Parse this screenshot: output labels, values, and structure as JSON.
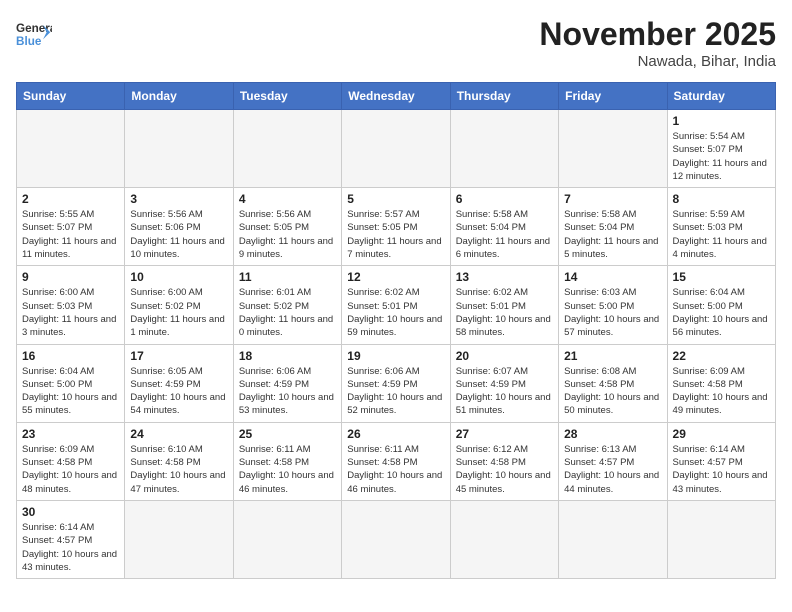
{
  "logo": {
    "text_general": "General",
    "text_blue": "Blue"
  },
  "title": "November 2025",
  "subtitle": "Nawada, Bihar, India",
  "days_of_week": [
    "Sunday",
    "Monday",
    "Tuesday",
    "Wednesday",
    "Thursday",
    "Friday",
    "Saturday"
  ],
  "weeks": [
    [
      {
        "day": "",
        "info": ""
      },
      {
        "day": "",
        "info": ""
      },
      {
        "day": "",
        "info": ""
      },
      {
        "day": "",
        "info": ""
      },
      {
        "day": "",
        "info": ""
      },
      {
        "day": "",
        "info": ""
      },
      {
        "day": "1",
        "info": "Sunrise: 5:54 AM\nSunset: 5:07 PM\nDaylight: 11 hours and 12 minutes."
      }
    ],
    [
      {
        "day": "2",
        "info": "Sunrise: 5:55 AM\nSunset: 5:07 PM\nDaylight: 11 hours and 11 minutes."
      },
      {
        "day": "3",
        "info": "Sunrise: 5:56 AM\nSunset: 5:06 PM\nDaylight: 11 hours and 10 minutes."
      },
      {
        "day": "4",
        "info": "Sunrise: 5:56 AM\nSunset: 5:05 PM\nDaylight: 11 hours and 9 minutes."
      },
      {
        "day": "5",
        "info": "Sunrise: 5:57 AM\nSunset: 5:05 PM\nDaylight: 11 hours and 7 minutes."
      },
      {
        "day": "6",
        "info": "Sunrise: 5:58 AM\nSunset: 5:04 PM\nDaylight: 11 hours and 6 minutes."
      },
      {
        "day": "7",
        "info": "Sunrise: 5:58 AM\nSunset: 5:04 PM\nDaylight: 11 hours and 5 minutes."
      },
      {
        "day": "8",
        "info": "Sunrise: 5:59 AM\nSunset: 5:03 PM\nDaylight: 11 hours and 4 minutes."
      }
    ],
    [
      {
        "day": "9",
        "info": "Sunrise: 6:00 AM\nSunset: 5:03 PM\nDaylight: 11 hours and 3 minutes."
      },
      {
        "day": "10",
        "info": "Sunrise: 6:00 AM\nSunset: 5:02 PM\nDaylight: 11 hours and 1 minute."
      },
      {
        "day": "11",
        "info": "Sunrise: 6:01 AM\nSunset: 5:02 PM\nDaylight: 11 hours and 0 minutes."
      },
      {
        "day": "12",
        "info": "Sunrise: 6:02 AM\nSunset: 5:01 PM\nDaylight: 10 hours and 59 minutes."
      },
      {
        "day": "13",
        "info": "Sunrise: 6:02 AM\nSunset: 5:01 PM\nDaylight: 10 hours and 58 minutes."
      },
      {
        "day": "14",
        "info": "Sunrise: 6:03 AM\nSunset: 5:00 PM\nDaylight: 10 hours and 57 minutes."
      },
      {
        "day": "15",
        "info": "Sunrise: 6:04 AM\nSunset: 5:00 PM\nDaylight: 10 hours and 56 minutes."
      }
    ],
    [
      {
        "day": "16",
        "info": "Sunrise: 6:04 AM\nSunset: 5:00 PM\nDaylight: 10 hours and 55 minutes."
      },
      {
        "day": "17",
        "info": "Sunrise: 6:05 AM\nSunset: 4:59 PM\nDaylight: 10 hours and 54 minutes."
      },
      {
        "day": "18",
        "info": "Sunrise: 6:06 AM\nSunset: 4:59 PM\nDaylight: 10 hours and 53 minutes."
      },
      {
        "day": "19",
        "info": "Sunrise: 6:06 AM\nSunset: 4:59 PM\nDaylight: 10 hours and 52 minutes."
      },
      {
        "day": "20",
        "info": "Sunrise: 6:07 AM\nSunset: 4:59 PM\nDaylight: 10 hours and 51 minutes."
      },
      {
        "day": "21",
        "info": "Sunrise: 6:08 AM\nSunset: 4:58 PM\nDaylight: 10 hours and 50 minutes."
      },
      {
        "day": "22",
        "info": "Sunrise: 6:09 AM\nSunset: 4:58 PM\nDaylight: 10 hours and 49 minutes."
      }
    ],
    [
      {
        "day": "23",
        "info": "Sunrise: 6:09 AM\nSunset: 4:58 PM\nDaylight: 10 hours and 48 minutes."
      },
      {
        "day": "24",
        "info": "Sunrise: 6:10 AM\nSunset: 4:58 PM\nDaylight: 10 hours and 47 minutes."
      },
      {
        "day": "25",
        "info": "Sunrise: 6:11 AM\nSunset: 4:58 PM\nDaylight: 10 hours and 46 minutes."
      },
      {
        "day": "26",
        "info": "Sunrise: 6:11 AM\nSunset: 4:58 PM\nDaylight: 10 hours and 46 minutes."
      },
      {
        "day": "27",
        "info": "Sunrise: 6:12 AM\nSunset: 4:58 PM\nDaylight: 10 hours and 45 minutes."
      },
      {
        "day": "28",
        "info": "Sunrise: 6:13 AM\nSunset: 4:57 PM\nDaylight: 10 hours and 44 minutes."
      },
      {
        "day": "29",
        "info": "Sunrise: 6:14 AM\nSunset: 4:57 PM\nDaylight: 10 hours and 43 minutes."
      }
    ],
    [
      {
        "day": "30",
        "info": "Sunrise: 6:14 AM\nSunset: 4:57 PM\nDaylight: 10 hours and 43 minutes."
      },
      {
        "day": "",
        "info": ""
      },
      {
        "day": "",
        "info": ""
      },
      {
        "day": "",
        "info": ""
      },
      {
        "day": "",
        "info": ""
      },
      {
        "day": "",
        "info": ""
      },
      {
        "day": "",
        "info": ""
      }
    ]
  ]
}
